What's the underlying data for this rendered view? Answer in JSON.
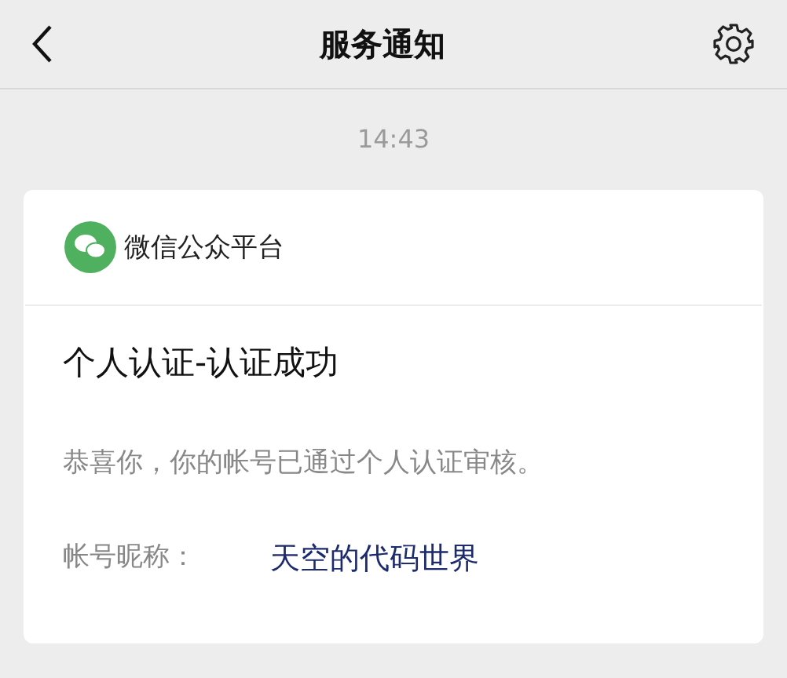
{
  "nav_bar": {
    "title": "服务通知"
  },
  "timestamp": "14:43",
  "message_card": {
    "sender": "微信公众平台",
    "title": "个人认证-认证成功",
    "body": "恭喜你，你的帐号已通过个人认证审核。",
    "fields": [
      {
        "label": "帐号昵称：",
        "value": "天空的代码世界"
      }
    ]
  }
}
